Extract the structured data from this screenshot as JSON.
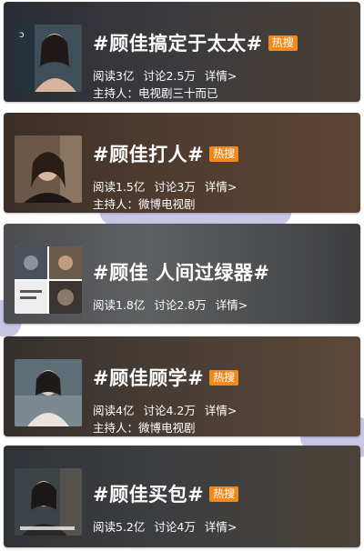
{
  "topics": [
    {
      "title": "#顾佳搞定于太太#",
      "badge": "热搜",
      "reads": "阅读3亿",
      "discussions": "讨论2.5万",
      "details": "详情>",
      "host": "主持人：电视剧三十而已"
    },
    {
      "title": "#顾佳打人#",
      "badge": "热搜",
      "reads": "阅读1.5亿",
      "discussions": "讨论3万",
      "details": "详情>",
      "host": "主持人：微博电视剧"
    },
    {
      "title": "#顾佳 人间过绿器#",
      "reads": "阅读1.8亿",
      "discussions": "讨论2.8万",
      "details": "详情>"
    },
    {
      "title": "#顾佳顾学#",
      "badge": "热搜",
      "reads": "阅读4亿",
      "discussions": "讨论4.2万",
      "details": "详情>",
      "host": "主持人：微博电视剧"
    },
    {
      "title": "#顾佳买包#",
      "badge": "热搜",
      "reads": "阅读5.2亿",
      "discussions": "讨论4万",
      "details": "详情>"
    }
  ],
  "colors": {
    "badge": "#f08a1c",
    "text": "#ffffff"
  }
}
